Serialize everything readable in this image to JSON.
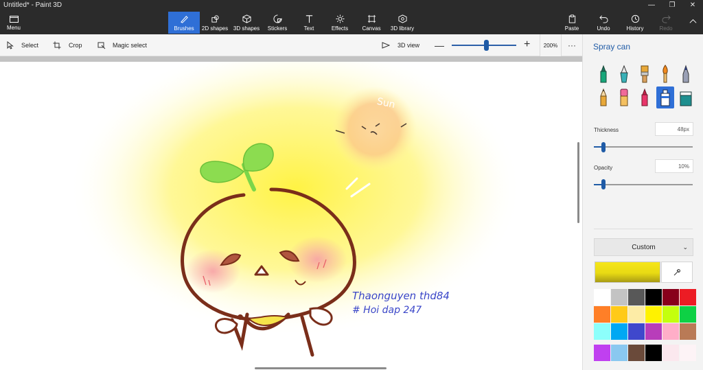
{
  "window": {
    "title": "Untitled* - Paint 3D",
    "controls": [
      "minimize",
      "maximize",
      "close"
    ]
  },
  "menu": {
    "label": "Menu",
    "icon": "folder-icon"
  },
  "ribbon": {
    "tools": [
      {
        "id": "brushes",
        "label": "Brushes",
        "icon": "brush-icon",
        "active": true
      },
      {
        "id": "2d-shapes",
        "label": "2D shapes",
        "icon": "shapes-2d-icon"
      },
      {
        "id": "3d-shapes",
        "label": "3D shapes",
        "icon": "cube-icon"
      },
      {
        "id": "stickers",
        "label": "Stickers",
        "icon": "sticker-icon"
      },
      {
        "id": "text",
        "label": "Text",
        "icon": "text-icon"
      },
      {
        "id": "effects",
        "label": "Effects",
        "icon": "sun-icon"
      },
      {
        "id": "canvas",
        "label": "Canvas",
        "icon": "canvas-icon"
      },
      {
        "id": "3d-library",
        "label": "3D library",
        "icon": "library-icon"
      }
    ],
    "right_tools": [
      {
        "id": "paste",
        "label": "Paste",
        "icon": "clipboard-icon"
      },
      {
        "id": "undo",
        "label": "Undo",
        "icon": "undo-icon"
      },
      {
        "id": "history",
        "label": "History",
        "icon": "history-icon"
      },
      {
        "id": "redo",
        "label": "Redo",
        "icon": "redo-icon",
        "disabled": true
      }
    ]
  },
  "subbar": {
    "select_label": "Select",
    "crop_label": "Crop",
    "magic_select_label": "Magic select",
    "view_3d_label": "3D view",
    "zoom_minus": "—",
    "zoom_plus": "+",
    "zoom_value": "200%",
    "zoom_level_fraction": 0.53,
    "more": "···"
  },
  "canvas": {
    "drawing_text": {
      "sun": "Sun",
      "author": "Thaonguyen thd84",
      "tag": "# Hoi dap 247"
    },
    "colors": {
      "outline": "#7a2e1a",
      "sprout": "#7cd64a",
      "glow": "#fff36a",
      "blush": "#f59aa0",
      "signature": "#3a46c8"
    }
  },
  "panel": {
    "title": "Spray can",
    "brushes": [
      {
        "name": "marker",
        "color": "#17a67a"
      },
      {
        "name": "calligraphy-pen",
        "color": "#39b0b7"
      },
      {
        "name": "oil-brush",
        "color": "#e8a838"
      },
      {
        "name": "watercolor",
        "color": "#f28a1e"
      },
      {
        "name": "pixel-pen",
        "color": "#2f8fd8"
      },
      {
        "name": "pencil",
        "color": "#e8a838"
      },
      {
        "name": "eraser",
        "color": "#f06a9a"
      },
      {
        "name": "crayon",
        "color": "#e8356a"
      },
      {
        "name": "spray-can",
        "color": "#ffffff",
        "active": true
      },
      {
        "name": "fill",
        "color": "#1e8f8f"
      }
    ],
    "thickness_label": "Thickness",
    "thickness_value": "48px",
    "thickness_fraction": 0.1,
    "opacity_label": "Opacity",
    "opacity_value": "10%",
    "opacity_fraction": 0.1,
    "color_mode": "Custom",
    "current_color": "#f6e61a",
    "palette": [
      "#ffffff",
      "#c3c3c3",
      "#585858",
      "#000000",
      "#88001b",
      "#ec1c24",
      "#ff7f27",
      "#ffca18",
      "#fdeca6",
      "#fff200",
      "#c4ff0e",
      "#0ed145",
      "#8cfffb",
      "#00a8f3",
      "#3f48cc",
      "#b83dba",
      "#ffaec8",
      "#b97a56"
    ],
    "custom_colors": [
      "#c040f0",
      "#8ac8f0",
      "#6a4a3a",
      "#000000",
      "#fbe8ee",
      "#fdf3f6"
    ]
  }
}
